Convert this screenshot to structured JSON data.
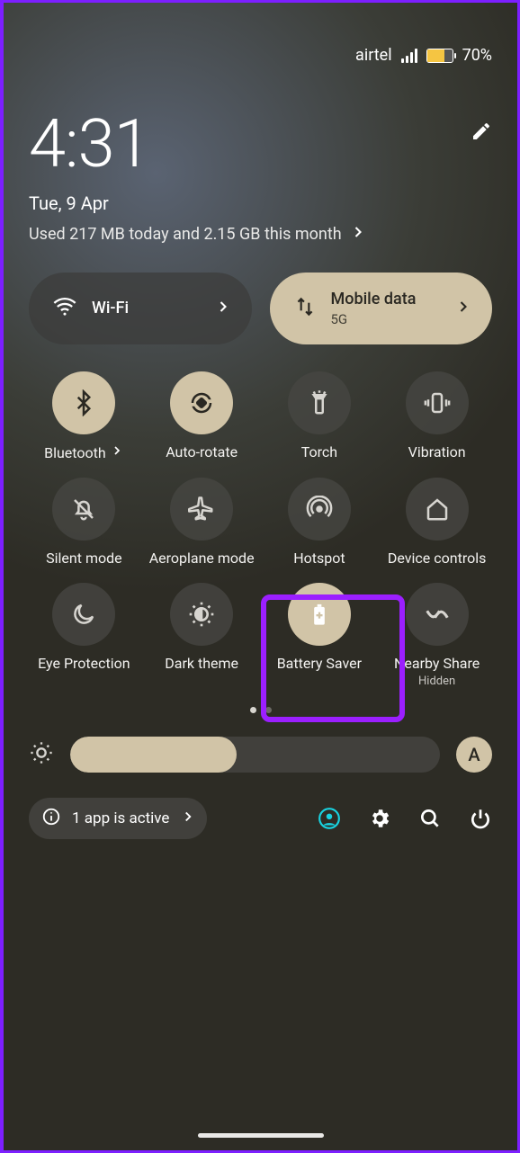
{
  "statusbar": {
    "carrier": "airtel",
    "battery_pct": "70%"
  },
  "header": {
    "time": "4:31",
    "date": "Tue, 9 Apr",
    "usage": "Used 217 MB today and 2.15 GB this month"
  },
  "big_tiles": {
    "wifi": {
      "label": "Wi-Fi"
    },
    "mobile": {
      "label": "Mobile data",
      "sub": "5G"
    }
  },
  "tiles": {
    "bluetooth": "Bluetooth",
    "autorotate": "Auto-rotate",
    "torch": "Torch",
    "vibration": "Vibration",
    "silent": "Silent mode",
    "aeroplane": "Aeroplane mode",
    "hotspot": "Hotspot",
    "device_controls": "Device controls",
    "eye": "Eye Protection",
    "dark": "Dark theme",
    "battery_saver": "Battery Saver",
    "nearby": "Nearby Share",
    "nearby_sub": "Hidden"
  },
  "bottom": {
    "active_apps": "1 app is active",
    "avatar": "A"
  },
  "colors": {
    "accent": "#d1c4a7",
    "tile_dark": "rgba(70,70,66,0.78)",
    "highlight": "#9b1fff"
  }
}
